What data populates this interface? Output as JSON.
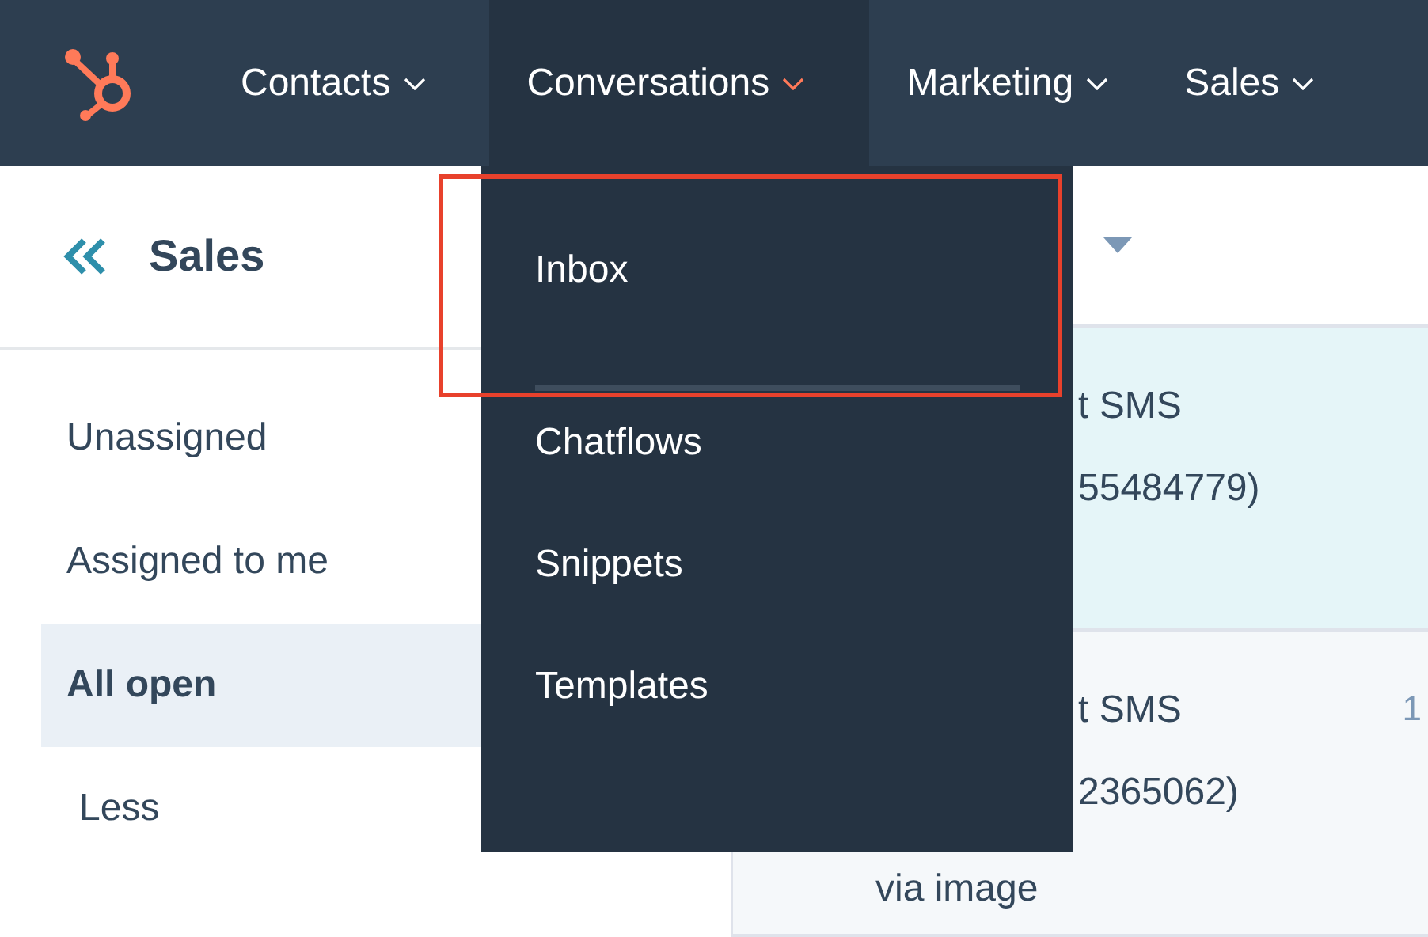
{
  "nav": {
    "items": [
      {
        "label": "Contacts",
        "selected": false
      },
      {
        "label": "Conversations",
        "selected": true
      },
      {
        "label": "Marketing",
        "selected": false
      },
      {
        "label": "Sales",
        "selected": false
      }
    ]
  },
  "dropdown": {
    "items": [
      {
        "label": "Inbox",
        "highlighted": true
      },
      {
        "label": "Chatflows",
        "highlighted": false
      },
      {
        "label": "Snippets",
        "highlighted": false
      },
      {
        "label": "Templates",
        "highlighted": false
      }
    ]
  },
  "sidebar": {
    "title": "Sales",
    "items": [
      {
        "label": "Unassigned",
        "selected": false
      },
      {
        "label": "Assigned to me",
        "selected": false
      },
      {
        "label": "All open",
        "selected": true
      },
      {
        "label": "Less",
        "selected": false
      }
    ]
  },
  "threads": [
    {
      "selected": true,
      "lines": [
        "t SMS",
        "55484779)"
      ]
    },
    {
      "selected": false,
      "lines": [
        "t SMS",
        "2365062)"
      ],
      "time": "1",
      "preview": "via image"
    }
  ]
}
